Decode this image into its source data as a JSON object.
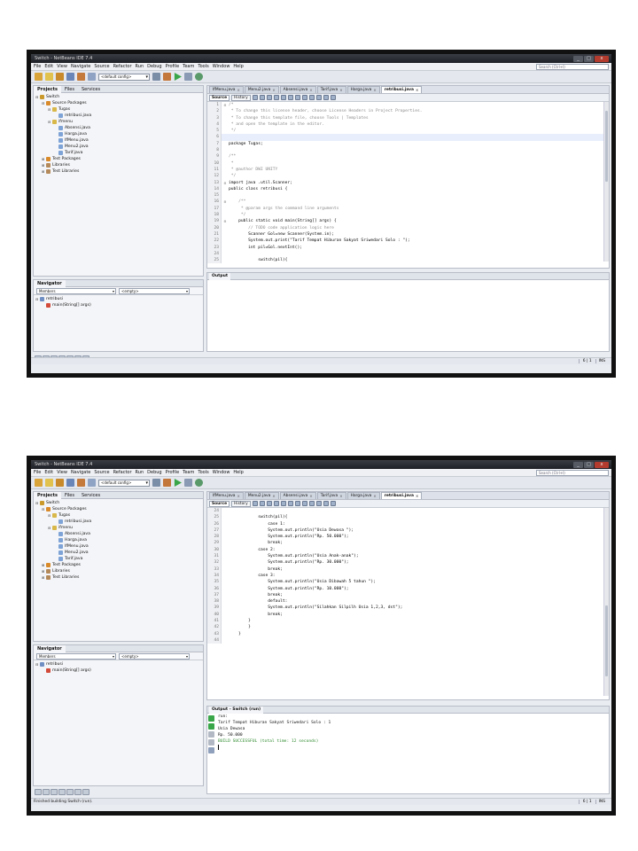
{
  "window": {
    "title": "Switch - NetBeans IDE 7.4",
    "min": "_",
    "max": "□",
    "close": "x"
  },
  "menu": [
    "File",
    "Edit",
    "View",
    "Navigate",
    "Source",
    "Refactor",
    "Run",
    "Debug",
    "Profile",
    "Team",
    "Tools",
    "Window",
    "Help"
  ],
  "search": {
    "placeholder": "Search (Ctrl+I)"
  },
  "toolbar": {
    "config": "<default config>"
  },
  "projects": {
    "tabs": [
      "Projects",
      "Files",
      "Services"
    ],
    "tree": [
      {
        "label": "Switch",
        "depth": 0,
        "exp": "⊟",
        "color": "#c9992b"
      },
      {
        "label": "Source Packages",
        "depth": 1,
        "exp": "⊟",
        "color": "#d98a2a"
      },
      {
        "label": "Tugas",
        "depth": 2,
        "exp": "⊟",
        "color": "#d9b84a"
      },
      {
        "label": "retribusi.java",
        "depth": 3,
        "exp": "",
        "color": "#7ea3d6"
      },
      {
        "label": "ifmenu",
        "depth": 2,
        "exp": "⊟",
        "color": "#d9b84a"
      },
      {
        "label": "Absensi.java",
        "depth": 3,
        "exp": "",
        "color": "#7ea3d6"
      },
      {
        "label": "Harga.java",
        "depth": 3,
        "exp": "",
        "color": "#7ea3d6"
      },
      {
        "label": "IfMenu.java",
        "depth": 3,
        "exp": "",
        "color": "#7ea3d6"
      },
      {
        "label": "Menu2.java",
        "depth": 3,
        "exp": "",
        "color": "#7ea3d6"
      },
      {
        "label": "Tarif.java",
        "depth": 3,
        "exp": "",
        "color": "#7ea3d6"
      },
      {
        "label": "Test Packages",
        "depth": 1,
        "exp": "⊞",
        "color": "#d98a2a"
      },
      {
        "label": "Libraries",
        "depth": 1,
        "exp": "⊞",
        "color": "#b58a5a"
      },
      {
        "label": "Test Libraries",
        "depth": 1,
        "exp": "⊞",
        "color": "#b58a5a"
      }
    ]
  },
  "navigator": {
    "title": "Navigator",
    "members": "Members",
    "empty": "<empty>",
    "tree": [
      {
        "label": "retribusi",
        "depth": 0,
        "exp": "⊟",
        "color": "#6f8fc4"
      },
      {
        "label": "main(String[] args)",
        "depth": 1,
        "exp": "",
        "color": "#d24a3a"
      }
    ]
  },
  "editor": {
    "source_btn": "Source",
    "history_btn": "History",
    "tabs_top": [
      {
        "label": "IfMenu.java",
        "active": false
      },
      {
        "label": "Menu2.java",
        "active": false
      },
      {
        "label": "Absensi.java",
        "active": false
      },
      {
        "label": "Tarif.java",
        "active": false
      },
      {
        "label": "Harga.java",
        "active": false
      },
      {
        "label": "retribusi.java",
        "active": true
      }
    ],
    "tabs_bottom": [
      {
        "label": "IfMenu.java",
        "active": false
      },
      {
        "label": "Menu2.java",
        "active": false
      },
      {
        "label": "Absensi.java",
        "active": false
      },
      {
        "label": "Tarif.java",
        "active": false
      },
      {
        "label": "Harga.java",
        "active": false
      },
      {
        "label": "retribusi.java",
        "active": true
      }
    ],
    "code_top": [
      {
        "n": "1",
        "f": "⊟",
        "t": "/*",
        "c": "cm"
      },
      {
        "n": "2",
        "f": "",
        "t": " * To change this license header, choose License Headers in Project Properties.",
        "c": "cm"
      },
      {
        "n": "3",
        "f": "",
        "t": " * To change this template file, choose Tools | Templates",
        "c": "cm"
      },
      {
        "n": "4",
        "f": "",
        "t": " * and open the template in the editor.",
        "c": "cm"
      },
      {
        "n": "5",
        "f": "",
        "t": " */",
        "c": "cm"
      },
      {
        "n": "6",
        "f": "",
        "t": "",
        "c": "",
        "hl": true
      },
      {
        "n": "7",
        "f": "",
        "t": "package Tugas;",
        "c": ""
      },
      {
        "n": "8",
        "f": "",
        "t": "",
        "c": ""
      },
      {
        "n": "9",
        "f": "",
        "t": "/**",
        "c": "cm"
      },
      {
        "n": "10",
        "f": "",
        "t": " *",
        "c": "cm"
      },
      {
        "n": "11",
        "f": "",
        "t": " * @author DWI UNITY",
        "c": "cm"
      },
      {
        "n": "12",
        "f": "",
        "t": " */",
        "c": "cm"
      },
      {
        "n": "13",
        "f": "⊟",
        "t": "import java .util.Scanner;",
        "c": ""
      },
      {
        "n": "14",
        "f": "",
        "t": "public class retribusi {",
        "c": ""
      },
      {
        "n": "15",
        "f": "",
        "t": "",
        "c": ""
      },
      {
        "n": "16",
        "f": "⊟",
        "t": "    /**",
        "c": "cm"
      },
      {
        "n": "17",
        "f": "",
        "t": "     * @param args the command line arguments",
        "c": "cm"
      },
      {
        "n": "18",
        "f": "",
        "t": "     */",
        "c": "cm"
      },
      {
        "n": "19",
        "f": "⊟",
        "t": "    public static void main(String[] args) {",
        "c": ""
      },
      {
        "n": "20",
        "f": "",
        "t": "        // TODO code application logic here",
        "c": "cm"
      },
      {
        "n": "21",
        "f": "",
        "t": "        Scanner Gol=new Scanner(System.in);",
        "c": ""
      },
      {
        "n": "22",
        "f": "",
        "t": "        System.out.print(\"Tarif Tempat Hiburan Sakyat Sriwedari Solo : \");",
        "c": ""
      },
      {
        "n": "23",
        "f": "",
        "t": "        int pil=Gol.nextInt();",
        "c": ""
      },
      {
        "n": "24",
        "f": "",
        "t": "",
        "c": ""
      },
      {
        "n": "25",
        "f": "",
        "t": "            switch(pil){",
        "c": ""
      }
    ],
    "code_bottom": [
      {
        "n": "24",
        "f": "",
        "t": "",
        "c": ""
      },
      {
        "n": "25",
        "f": "",
        "t": "            switch(pil){",
        "c": ""
      },
      {
        "n": "26",
        "f": "",
        "t": "                case 1:",
        "c": ""
      },
      {
        "n": "27",
        "f": "",
        "t": "                System.out.println(\"Usia Dewasa \");",
        "c": ""
      },
      {
        "n": "28",
        "f": "",
        "t": "                System.out.println(\"Rp. 50.000\");",
        "c": ""
      },
      {
        "n": "29",
        "f": "",
        "t": "                break;",
        "c": ""
      },
      {
        "n": "30",
        "f": "",
        "t": "            case 2:",
        "c": ""
      },
      {
        "n": "31",
        "f": "",
        "t": "                System.out.println(\"Usia Anak-anak\");",
        "c": ""
      },
      {
        "n": "32",
        "f": "",
        "t": "                System.out.println(\"Rp. 30.000\");",
        "c": ""
      },
      {
        "n": "33",
        "f": "",
        "t": "                break;",
        "c": ""
      },
      {
        "n": "34",
        "f": "",
        "t": "            case 3:",
        "c": ""
      },
      {
        "n": "35",
        "f": "",
        "t": "                System.out.println(\"Usia Dibawah 5 tahun \");",
        "c": ""
      },
      {
        "n": "36",
        "f": "",
        "t": "                System.out.println(\"Rp. 10.000\");",
        "c": ""
      },
      {
        "n": "37",
        "f": "",
        "t": "                break;",
        "c": ""
      },
      {
        "n": "38",
        "f": "",
        "t": "                default:",
        "c": ""
      },
      {
        "n": "39",
        "f": "",
        "t": "                System.out.println(\"Silahkan Silpilh Usia 1,2,3, dst\");",
        "c": ""
      },
      {
        "n": "40",
        "f": "",
        "t": "                break;",
        "c": ""
      },
      {
        "n": "41",
        "f": "",
        "t": "        }",
        "c": ""
      },
      {
        "n": "42",
        "f": "",
        "t": "        }",
        "c": ""
      },
      {
        "n": "43",
        "f": "",
        "t": "    }",
        "c": ""
      },
      {
        "n": "44",
        "f": "",
        "t": "",
        "c": ""
      }
    ]
  },
  "output_top": {
    "tab": "Output"
  },
  "output_bottom": {
    "tab": "Output - Switch (run)",
    "lines": [
      {
        "t": "run:",
        "ok": false
      },
      {
        "t": "Tarif Tempat Hiburan Sakyat Sriwedari Solo : 1",
        "ok": false
      },
      {
        "t": "Usia Dewasa",
        "ok": false
      },
      {
        "t": "Rp. 50.000",
        "ok": false
      },
      {
        "t": "BUILD SUCCESSFUL (total time: 12 seconds)",
        "ok": true
      }
    ]
  },
  "status_top": {
    "left": "",
    "pos": "6 | 1",
    "ins": "INS"
  },
  "status_bottom": {
    "left": "Finished building Switch (run).",
    "pos": "6 | 1",
    "ins": "INS"
  },
  "colors": {
    "accent": "#0000c8",
    "ok": "#2d8a2d"
  }
}
